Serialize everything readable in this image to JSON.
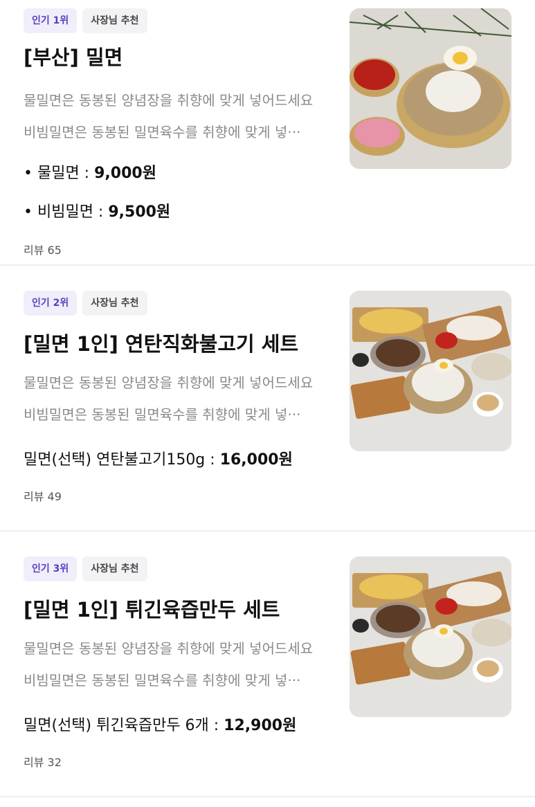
{
  "menu_items": [
    {
      "rank_badge": "인기 1위",
      "owner_badge": "사장님 추천",
      "title": "[부산] 밀면",
      "desc_line1": "물밀면은 동봉된 양념장을 취향에 맞게 넣어드세요",
      "desc_line2": "비빔밀면은 동봉된 밀면육수를 취향에 맞게 넣···",
      "prices": [
        {
          "label": "• 물밀면 :",
          "amount": "9,000원"
        },
        {
          "label": "• 비빔밀면 :",
          "amount": "9,500원"
        }
      ],
      "review": "리뷰 65",
      "image_icon": "cold-noodle-bowl-photo"
    },
    {
      "rank_badge": "인기 2위",
      "owner_badge": "사장님 추천",
      "title": "[밀면 1인] 연탄직화불고기 세트",
      "desc_line1": "물밀면은 동봉된 양념장을 취향에 맞게 넣어드세요",
      "desc_line2": "비빔밀면은 동봉된 밀면육수를 취향에 맞게 넣···",
      "prices": [
        {
          "label": "밀면(선택) 연탄불고기150g :",
          "amount": "16,000원"
        }
      ],
      "review": "리뷰 49",
      "image_icon": "bulgogi-set-photo"
    },
    {
      "rank_badge": "인기 3위",
      "owner_badge": "사장님 추천",
      "title": "[밀면 1인] 튀긴육즙만두 세트",
      "desc_line1": "물밀면은 동봉된 양념장을 취향에 맞게 넣어드세요",
      "desc_line2": "비빔밀면은 동봉된 밀면육수를 취향에 맞게 넣···",
      "prices": [
        {
          "label": "밀면(선택) 튀긴육즙만두 6개 :",
          "amount": "12,900원"
        }
      ],
      "review": "리뷰 32",
      "image_icon": "dumpling-set-photo"
    }
  ]
}
